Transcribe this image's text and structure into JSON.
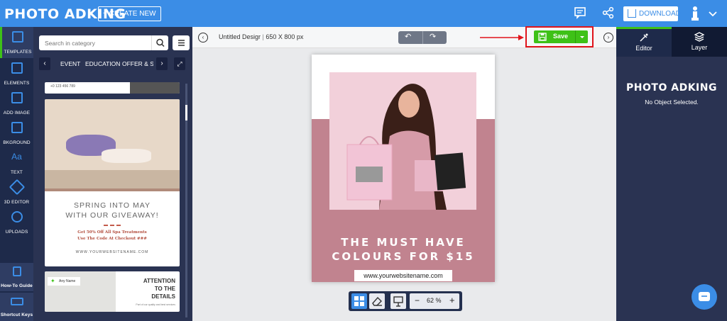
{
  "app": {
    "logo": "PHOTO ADKING",
    "create_new": "+ CREATE NEW",
    "download": "DOWNLOAD"
  },
  "leftbar": {
    "items": [
      {
        "label": "TEMPLATES",
        "icon": "templates-icon"
      },
      {
        "label": "ELEMENTS",
        "icon": "elements-icon"
      },
      {
        "label": "ADD IMAGE",
        "icon": "add-image-icon"
      },
      {
        "label": "BKGROUND",
        "icon": "background-icon"
      },
      {
        "label": "TEXT",
        "icon": "text-icon"
      },
      {
        "label": "3D EDITOR",
        "icon": "3d-editor-icon"
      },
      {
        "label": "UPLOADS",
        "icon": "uploads-icon"
      }
    ],
    "bottom": [
      {
        "label": "How-To Guide",
        "icon": "guide-icon"
      },
      {
        "label": "Shortcut Keys",
        "icon": "keyboard-icon"
      }
    ]
  },
  "panel": {
    "search_placeholder": "Search in category",
    "categories": [
      "EVENT",
      "EDUCATION",
      "OFFER & SA"
    ],
    "templates": {
      "phone": "+0 123 456 789",
      "spring_line1": "SPRING INTO MAY",
      "spring_line2": "WITH OUR GIVEAWAY!",
      "spring_offer1": "Get 50% Off All Spa Treatments",
      "spring_offer2": "Use The Code At Checkout ###",
      "spring_url": "WWW.YOURWEBSITENAME.COM",
      "attention_logo": "Any Name",
      "attention_line1": "ATTENTION",
      "attention_line2": "TO THE",
      "attention_line3": "DETAILS",
      "attention_small": "Part of our quality and best services"
    }
  },
  "toolbar": {
    "doc_title": "Untitled Desigr",
    "doc_size": "650 X 800 px",
    "save": "Save"
  },
  "canvas": {
    "headline_1": "THE MUST HAVE",
    "headline_2": "COLOURS FOR $15",
    "url": "www.yourwebsitename.com"
  },
  "zoom": {
    "value": "62 %"
  },
  "right_panel": {
    "tabs": [
      "Editor",
      "Layer"
    ],
    "logo": "PHOTO ADKING",
    "status": "No Object Selected."
  },
  "colors": {
    "accent": "#3b8de6",
    "save": "#3ec117",
    "highlight": "#e0141b",
    "canvas_pink": "#c1838f"
  }
}
